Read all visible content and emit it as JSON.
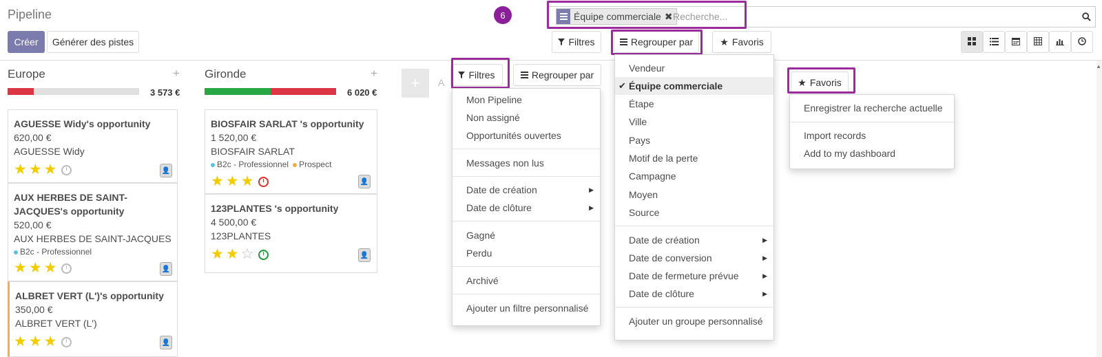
{
  "breadcrumb": "Pipeline",
  "buttons": {
    "create": "Créer",
    "generate": "Générer des pistes"
  },
  "step_badge": "6",
  "search": {
    "facet_label": "Équipe commerciale",
    "facet_close": "✖",
    "placeholder": "Recherche..."
  },
  "toolbar": {
    "filters": "Filtres",
    "group_by": "Regrouper par",
    "favorites": "Favoris"
  },
  "views": [
    {
      "name": "kanban-view",
      "icon": "kanban-icon"
    },
    {
      "name": "list-view",
      "icon": "list-icon"
    },
    {
      "name": "calendar-view",
      "icon": "calendar-icon"
    },
    {
      "name": "pivot-view",
      "icon": "pivot-icon"
    },
    {
      "name": "graph-view",
      "icon": "graph-icon"
    },
    {
      "name": "activity-view",
      "icon": "clock-icon"
    }
  ],
  "columns": [
    {
      "title": "Europe",
      "total": "3 573",
      "currency": "€",
      "progress": [
        {
          "color": "#dc3545",
          "fraction": 0.2
        },
        {
          "color": "#e0e0e0",
          "fraction": 0.8
        }
      ],
      "cards": [
        {
          "title": "AGUESSE Widy's opportunity",
          "amount": "620,00 €",
          "partner": "AGUESSE Widy",
          "tags": [],
          "stars": 3,
          "activity": "grey"
        },
        {
          "title_line1": "AUX HERBES DE SAINT-",
          "title_line2": "JACQUES's opportunity",
          "amount": "520,00 €",
          "partner": "AUX HERBES DE SAINT-JACQUES",
          "tags": [
            {
              "label": "B2c - Professionnel",
              "color": "#5bc0de"
            }
          ],
          "stars": 3,
          "activity": "grey"
        },
        {
          "title": "ALBRET VERT (L')'s opportunity",
          "amount": "350,00 €",
          "partner": "ALBRET VERT (L')",
          "tags": [],
          "stars": 3,
          "activity": "grey"
        }
      ]
    },
    {
      "title": "Gironde",
      "total": "6 020",
      "currency": "€",
      "progress": [
        {
          "color": "#28a745",
          "fraction": 0.5
        },
        {
          "color": "#dc3545",
          "fraction": 0.5
        }
      ],
      "cards": [
        {
          "title": "BIOSFAIR SARLAT 's opportunity",
          "amount": "1 520,00 €",
          "partner": "BIOSFAIR SARLAT",
          "tags": [
            {
              "label": "B2c - Professionnel",
              "color": "#5bc0de"
            },
            {
              "label": "Prospect",
              "color": "#f0ad4e"
            }
          ],
          "stars": 3,
          "activity": "red"
        },
        {
          "title": "123PLANTES 's opportunity",
          "amount": "4 500,00 €",
          "partner": "123PLANTES",
          "tags": [],
          "stars": 2,
          "activity": "green"
        }
      ]
    }
  ],
  "add_column_hint": "A",
  "filters_menu": {
    "button": "Filtres",
    "items": [
      "Mon Pipeline",
      "Non assigné",
      "Opportunités ouvertes",
      "Messages non lus",
      "Date de création",
      "Date de clôture",
      "Gagné",
      "Perdu",
      "Archivé",
      "Ajouter un filtre personnalisé"
    ]
  },
  "groupby_secondary_button": "Regrouper par",
  "groupby_menu": {
    "items": [
      "Vendeur",
      "Équipe commerciale",
      "Étape",
      "Ville",
      "Pays",
      "Motif de la perte",
      "Campagne",
      "Moyen",
      "Source",
      "Date de création",
      "Date de conversion",
      "Date de fermeture prévue",
      "Date de clôture",
      "Ajouter un groupe personnalisé"
    ],
    "selected": "Équipe commerciale"
  },
  "favorites_menu": {
    "button": "Favoris",
    "items": [
      "Enregistrer la recherche actuelle",
      "Import records",
      "Add to my dashboard"
    ]
  },
  "accent_color": "#7c7bad",
  "highlight_color": "#9b2c9b"
}
